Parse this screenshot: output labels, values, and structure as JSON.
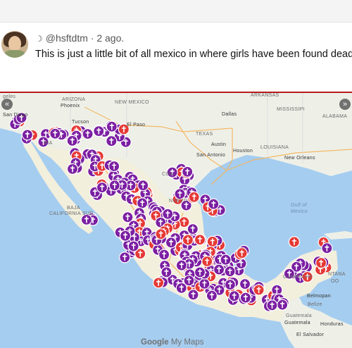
{
  "post": {
    "moon_icon": "☽",
    "handle": "@hsftdtm",
    "separator": "·",
    "age": "2 ago.",
    "text": "This is just a little bit of all mexico in where girls have been found dead"
  },
  "map": {
    "labels": {
      "arizona": "ARIZONA",
      "phoenix": "Phoenix",
      "new_mexico": "NEW MEXICO",
      "tucson": "Tucson",
      "el_paso": "El Paso",
      "angeles": "geles",
      "san_diego": "San Diego",
      "nia": "NIA",
      "texas": "TEXAS",
      "dallas": "Dallas",
      "austin": "Austin",
      "houston": "Houston",
      "san_antonio": "San Antonio",
      "arkansas": "ARKANSAS",
      "mississippi": "MISSISSIPI",
      "alabama": "ALABAMA",
      "louisiana": "LOUISIANA",
      "new_orleans": "New Orleans",
      "baja_1": "BAJA",
      "baja_2": "CALIFORNIA SUR",
      "gulf_1": "Gulf of",
      "gulf_2": "Mexico",
      "campeche": "CAMPECHE",
      "ntana": "NTANA",
      "oo": "OO",
      "belmopan": "Belmopan",
      "belize": "Belize",
      "guatemala": "Guatemala",
      "guatemala_city": "Guatemala",
      "honduras": "Honduras",
      "el_salvador": "El Salvador",
      "coa": "COA",
      "nuevo": "NUEVO"
    },
    "marker_colors": {
      "purple": "#7b1fa2",
      "red": "#e53935"
    },
    "marker_icon": "cross-icon",
    "prev_icon": "«",
    "next_icon": "»",
    "logo_google": "Google",
    "logo_maps": "My Maps"
  }
}
